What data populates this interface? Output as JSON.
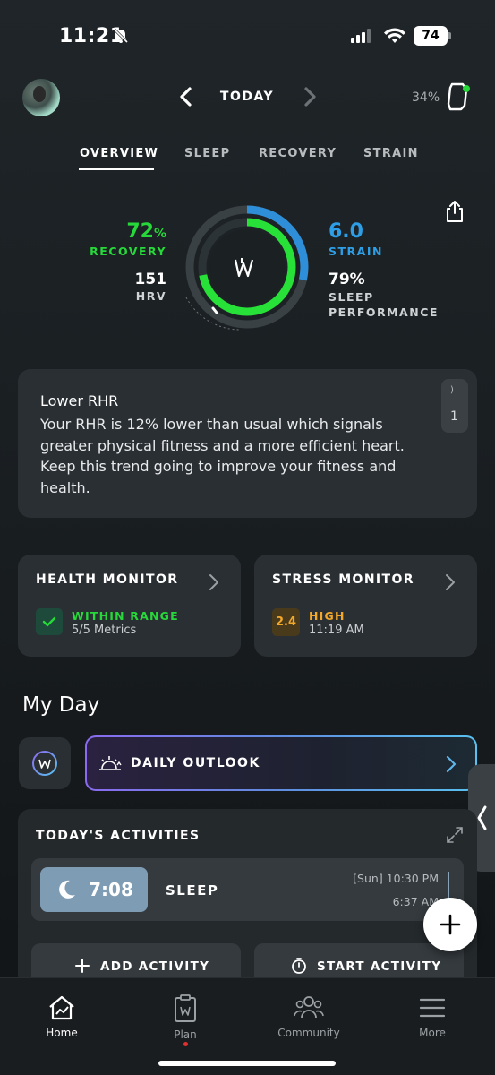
{
  "status_bar": {
    "time": "11:21",
    "battery": "74"
  },
  "header": {
    "date_label": "TODAY",
    "device_battery": "34%"
  },
  "tabs": [
    {
      "label": "OVERVIEW",
      "active": true
    },
    {
      "label": "SLEEP",
      "active": false
    },
    {
      "label": "RECOVERY",
      "active": false
    },
    {
      "label": "STRAIN",
      "active": false
    }
  ],
  "metrics": {
    "recovery": {
      "value": "72",
      "unit": "%",
      "label": "RECOVERY",
      "color": "#27d83a",
      "fraction": 0.72
    },
    "hrv": {
      "value": "151",
      "label": "HRV"
    },
    "strain": {
      "value": "6.0",
      "label": "STRAIN",
      "color": "#2e9fe6",
      "fraction": 0.286
    },
    "sleep_performance": {
      "value": "79%",
      "label": "SLEEP PERFORMANCE",
      "fraction": 0.79
    }
  },
  "insight": {
    "title": "Lower RHR",
    "body": "Your RHR is 12% lower than usual which signals greater physical fitness and a more efficient heart. Keep this trend going to improve your fitness and health.",
    "side_top": ")",
    "side_count": "1"
  },
  "health_monitor": {
    "title": "HEALTH MONITOR",
    "status": "WITHIN RANGE",
    "status_color": "#27d83a",
    "detail": "5/5 Metrics"
  },
  "stress_monitor": {
    "title": "STRESS MONITOR",
    "value": "2.4",
    "status": "HIGH",
    "status_color": "#f3a82a",
    "detail": "11:19 AM"
  },
  "my_day": {
    "title": "My Day",
    "daily_outlook": "DAILY OUTLOOK"
  },
  "activities": {
    "title": "TODAY'S ACTIVITIES",
    "items": [
      {
        "duration": "7:08",
        "label": "SLEEP",
        "start": "[Sun] 10:30 PM",
        "end": "6:37 AM"
      }
    ],
    "add_label": "ADD ACTIVITY",
    "start_label": "START ACTIVITY"
  },
  "bottom_nav": [
    {
      "label": "Home",
      "icon": "home-icon",
      "active": true
    },
    {
      "label": "Plan",
      "icon": "plan-icon",
      "active": false
    },
    {
      "label": "Community",
      "icon": "community-icon",
      "active": false
    },
    {
      "label": "More",
      "icon": "menu-icon",
      "active": false
    }
  ]
}
